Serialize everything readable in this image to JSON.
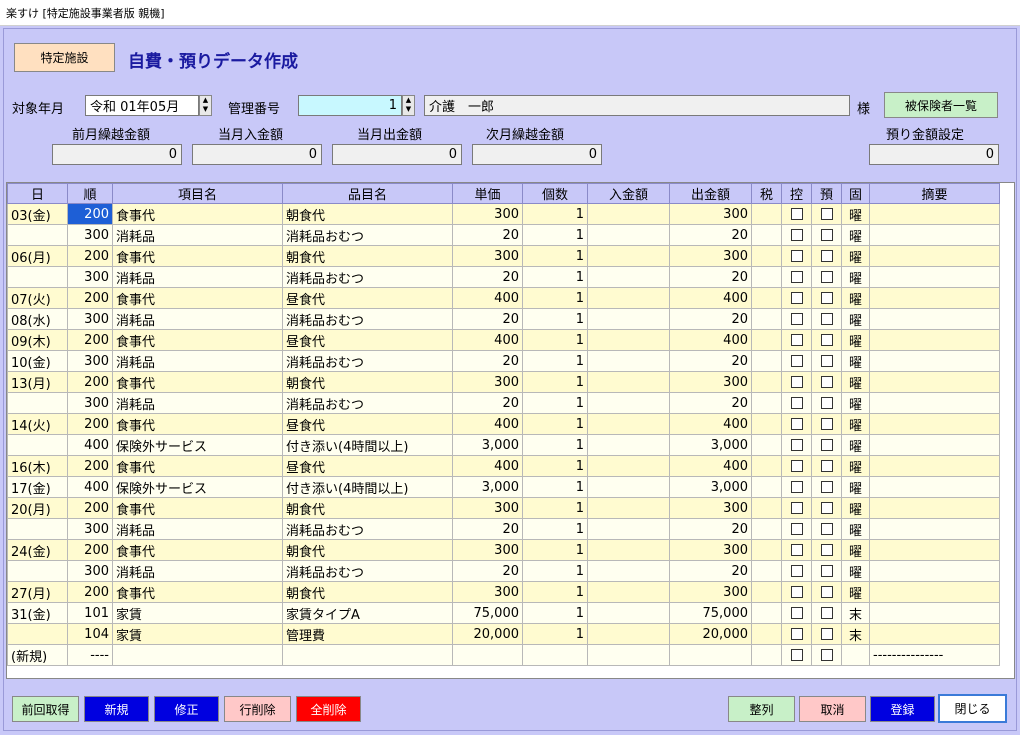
{
  "window": {
    "title": "楽すけ [特定施設事業者版 親機]"
  },
  "header": {
    "facility_button": "特定施設",
    "screen_title": "自費・預りデータ作成"
  },
  "form": {
    "target_month_label": "対象年月",
    "target_month_value": "令和 01年05月",
    "manage_no_label": "管理番号",
    "manage_no_value": "1",
    "person_name": "介護　一郎",
    "honorific": "様",
    "insured_list_button": "被保険者一覧",
    "prev_carry_label": "前月繰越金額",
    "prev_carry_value": "0",
    "in_label": "当月入金額",
    "in_value": "0",
    "out_label": "当月出金額",
    "out_value": "0",
    "next_carry_label": "次月繰越金額",
    "next_carry_value": "0",
    "deposit_setting_label": "預り金額設定",
    "deposit_setting_value": "0"
  },
  "table": {
    "columns": [
      "日",
      "順",
      "項目名",
      "品目名",
      "単価",
      "個数",
      "入金額",
      "出金額",
      "税",
      "控",
      "預",
      "固",
      "摘要"
    ],
    "rows": [
      {
        "day": "03(金)",
        "order": "200",
        "item": "食事代",
        "product": "朝食代",
        "price": "300",
        "qty": "1",
        "in": "",
        "out": "300",
        "fixed": "曜",
        "memo": ""
      },
      {
        "day": "",
        "order": "300",
        "item": "消耗品",
        "product": "消耗品おむつ",
        "price": "20",
        "qty": "1",
        "in": "",
        "out": "20",
        "fixed": "曜",
        "memo": ""
      },
      {
        "day": "06(月)",
        "order": "200",
        "item": "食事代",
        "product": "朝食代",
        "price": "300",
        "qty": "1",
        "in": "",
        "out": "300",
        "fixed": "曜",
        "memo": ""
      },
      {
        "day": "",
        "order": "300",
        "item": "消耗品",
        "product": "消耗品おむつ",
        "price": "20",
        "qty": "1",
        "in": "",
        "out": "20",
        "fixed": "曜",
        "memo": ""
      },
      {
        "day": "07(火)",
        "order": "200",
        "item": "食事代",
        "product": "昼食代",
        "price": "400",
        "qty": "1",
        "in": "",
        "out": "400",
        "fixed": "曜",
        "memo": ""
      },
      {
        "day": "08(水)",
        "order": "300",
        "item": "消耗品",
        "product": "消耗品おむつ",
        "price": "20",
        "qty": "1",
        "in": "",
        "out": "20",
        "fixed": "曜",
        "memo": ""
      },
      {
        "day": "09(木)",
        "order": "200",
        "item": "食事代",
        "product": "昼食代",
        "price": "400",
        "qty": "1",
        "in": "",
        "out": "400",
        "fixed": "曜",
        "memo": ""
      },
      {
        "day": "10(金)",
        "order": "300",
        "item": "消耗品",
        "product": "消耗品おむつ",
        "price": "20",
        "qty": "1",
        "in": "",
        "out": "20",
        "fixed": "曜",
        "memo": ""
      },
      {
        "day": "13(月)",
        "order": "200",
        "item": "食事代",
        "product": "朝食代",
        "price": "300",
        "qty": "1",
        "in": "",
        "out": "300",
        "fixed": "曜",
        "memo": ""
      },
      {
        "day": "",
        "order": "300",
        "item": "消耗品",
        "product": "消耗品おむつ",
        "price": "20",
        "qty": "1",
        "in": "",
        "out": "20",
        "fixed": "曜",
        "memo": ""
      },
      {
        "day": "14(火)",
        "order": "200",
        "item": "食事代",
        "product": "昼食代",
        "price": "400",
        "qty": "1",
        "in": "",
        "out": "400",
        "fixed": "曜",
        "memo": ""
      },
      {
        "day": "",
        "order": "400",
        "item": "保険外サービス",
        "product": "付き添い(4時間以上)",
        "price": "3,000",
        "qty": "1",
        "in": "",
        "out": "3,000",
        "fixed": "曜",
        "memo": ""
      },
      {
        "day": "16(木)",
        "order": "200",
        "item": "食事代",
        "product": "昼食代",
        "price": "400",
        "qty": "1",
        "in": "",
        "out": "400",
        "fixed": "曜",
        "memo": ""
      },
      {
        "day": "17(金)",
        "order": "400",
        "item": "保険外サービス",
        "product": "付き添い(4時間以上)",
        "price": "3,000",
        "qty": "1",
        "in": "",
        "out": "3,000",
        "fixed": "曜",
        "memo": ""
      },
      {
        "day": "20(月)",
        "order": "200",
        "item": "食事代",
        "product": "朝食代",
        "price": "300",
        "qty": "1",
        "in": "",
        "out": "300",
        "fixed": "曜",
        "memo": ""
      },
      {
        "day": "",
        "order": "300",
        "item": "消耗品",
        "product": "消耗品おむつ",
        "price": "20",
        "qty": "1",
        "in": "",
        "out": "20",
        "fixed": "曜",
        "memo": ""
      },
      {
        "day": "24(金)",
        "order": "200",
        "item": "食事代",
        "product": "朝食代",
        "price": "300",
        "qty": "1",
        "in": "",
        "out": "300",
        "fixed": "曜",
        "memo": ""
      },
      {
        "day": "",
        "order": "300",
        "item": "消耗品",
        "product": "消耗品おむつ",
        "price": "20",
        "qty": "1",
        "in": "",
        "out": "20",
        "fixed": "曜",
        "memo": ""
      },
      {
        "day": "27(月)",
        "order": "200",
        "item": "食事代",
        "product": "朝食代",
        "price": "300",
        "qty": "1",
        "in": "",
        "out": "300",
        "fixed": "曜",
        "memo": ""
      },
      {
        "day": "31(金)",
        "order": "101",
        "item": "家賃",
        "product": "家賃タイプA",
        "price": "75,000",
        "qty": "1",
        "in": "",
        "out": "75,000",
        "fixed": "末",
        "memo": ""
      },
      {
        "day": "",
        "order": "104",
        "item": "家賃",
        "product": "管理費",
        "price": "20,000",
        "qty": "1",
        "in": "",
        "out": "20,000",
        "fixed": "末",
        "memo": ""
      },
      {
        "day": "(新規)",
        "order": "----",
        "item": "",
        "product": "",
        "price": "",
        "qty": "",
        "in": "",
        "out": "",
        "fixed": "",
        "memo": "---------------"
      }
    ]
  },
  "footer": {
    "prev_fetch": "前回取得",
    "new": "新規",
    "modify": "修正",
    "delete_row": "行削除",
    "delete_all": "全削除",
    "sort": "整列",
    "cancel": "取消",
    "register": "登録",
    "close": "閉じる"
  },
  "colors": {
    "bg": "#c8c8f8",
    "title": "#1a1aa0",
    "blue_btn": "#0000e0",
    "red_btn": "#ff0000",
    "pink_btn": "#ffc8c8",
    "green_btn": "#c8f0c8"
  }
}
